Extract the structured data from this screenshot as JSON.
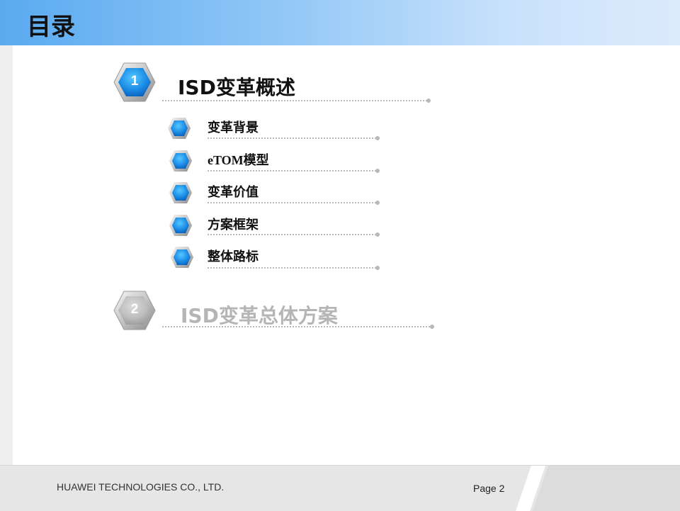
{
  "title": "目录",
  "sections": [
    {
      "number": "1",
      "title": "ISD变革概述",
      "active": true
    },
    {
      "number": "2",
      "title": "ISD变革总体方案",
      "active": false
    }
  ],
  "subitems": [
    {
      "label": "变革背景"
    },
    {
      "label": "eTOM模型"
    },
    {
      "label": "变革价值"
    },
    {
      "label": "方案框架"
    },
    {
      "label": "整体路标"
    }
  ],
  "footer": {
    "company": "HUAWEI TECHNOLOGIES CO., LTD.",
    "page": "Page 2"
  },
  "colors": {
    "header_start": "#5aaaf0",
    "header_end": "#dcebfc",
    "active_hex": "#1a8fe6",
    "inactive_hex": "#c9c9c9",
    "dots": "#b9b9b9"
  },
  "icons": {
    "section_marker": "hexagon-number-icon",
    "subitem_marker": "blue-hexagon-icon"
  }
}
